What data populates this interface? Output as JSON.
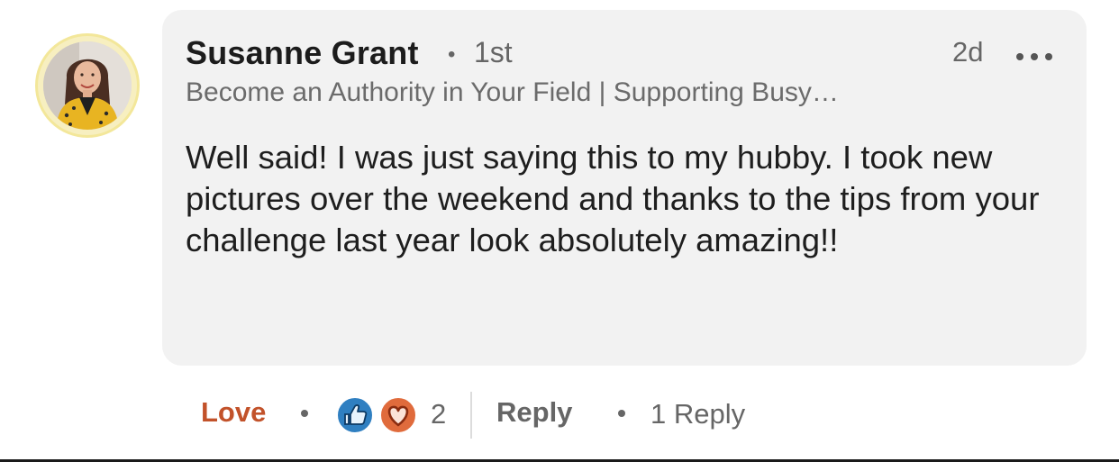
{
  "comment": {
    "author_name": "Susanne Grant",
    "connection_degree": "1st",
    "separator": "•",
    "time_ago": "2d",
    "headline": "Become an Authority in Your Field | Supporting Busy…",
    "text": "Well said! I was just saying this to my hubby. I took new pictures over the weekend and thanks to the tips from your challenge last year look absolutely amazing!!"
  },
  "actions": {
    "love_label": "Love",
    "reaction_count": "2",
    "reply_label": "Reply",
    "replies_count_label": "1 Reply"
  },
  "icons": {
    "more": "more-horizontal-icon",
    "like_reaction": "thumbs-up-icon",
    "love_reaction": "heart-icon"
  },
  "colors": {
    "love_accent": "#c2522a",
    "like_blue": "#2f7fc1",
    "love_orange": "#e06b3c",
    "bubble_bg": "#f2f2f2"
  }
}
